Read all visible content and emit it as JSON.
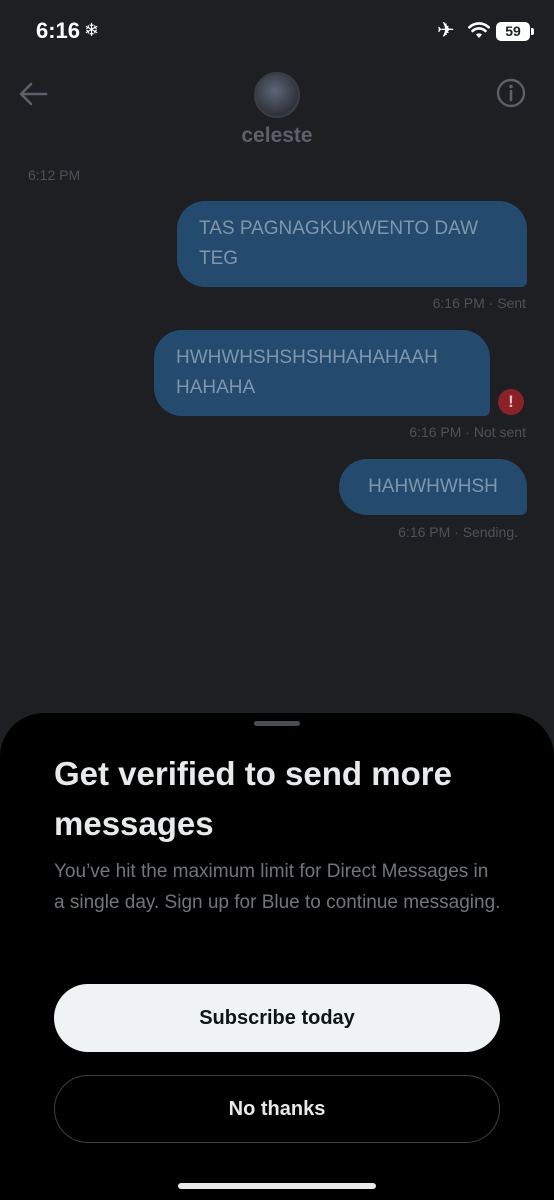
{
  "status_bar": {
    "time": "6:16",
    "battery": "59"
  },
  "header": {
    "contact_name": "celeste"
  },
  "chat": {
    "earlier_timestamp": "6:12 PM",
    "messages": [
      {
        "text": "TAS PAGNAGKUKWENTO DAW TEG",
        "time": "6:16 PM",
        "status": "· Sent"
      },
      {
        "text": "HWHWHSHSHSHHAHAHAAH HAHAHA",
        "time": "6:16 PM",
        "status": "· Not sent"
      },
      {
        "text": "HAHWHWHSH",
        "time": "6:16 PM",
        "status": "· Sending."
      }
    ]
  },
  "sheet": {
    "title": "Get verified to send more messages",
    "body": "You’ve hit the maximum limit for Direct Messages in a single day. Sign up for Blue to continue messaging.",
    "primary_button": "Subscribe today",
    "secondary_button": "No thanks"
  },
  "colors": {
    "bubble": "#244b6d",
    "sheet": "#000000",
    "error": "#8b2227"
  },
  "icons": [
    "snowflake-icon",
    "airplane-icon",
    "wifi-icon",
    "battery-icon",
    "back-arrow-icon",
    "info-icon",
    "error-icon"
  ]
}
